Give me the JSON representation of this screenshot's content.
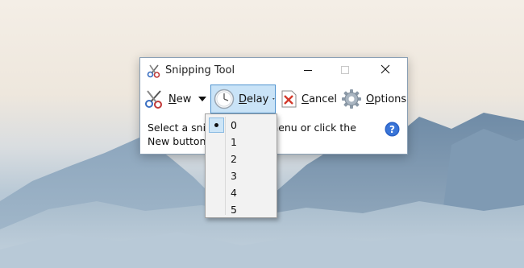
{
  "window": {
    "title": "Snipping Tool",
    "controls": {
      "minimize": "minimize",
      "maximize": "maximize",
      "close": "close"
    }
  },
  "toolbar": {
    "new_label": "New",
    "delay_label": "Delay",
    "cancel_label": "Cancel",
    "options_label": "Options"
  },
  "body": {
    "line1_left": "Select a snip",
    "line1_right": "menu or click the",
    "line2": "New button"
  },
  "delay_menu": {
    "selected": "0",
    "items": [
      "0",
      "1",
      "2",
      "3",
      "4",
      "5"
    ]
  },
  "icons": {
    "app": "scissors-icon",
    "new": "scissors-icon",
    "delay": "clock-icon",
    "cancel": "cancel-x-icon",
    "options": "gear-icon",
    "help": "help-icon"
  },
  "colors": {
    "delay_highlight": "#c9e3f7",
    "delay_border": "#4f93cf",
    "help_blue": "#2b62c6",
    "cancel_red": "#d33a2c"
  }
}
